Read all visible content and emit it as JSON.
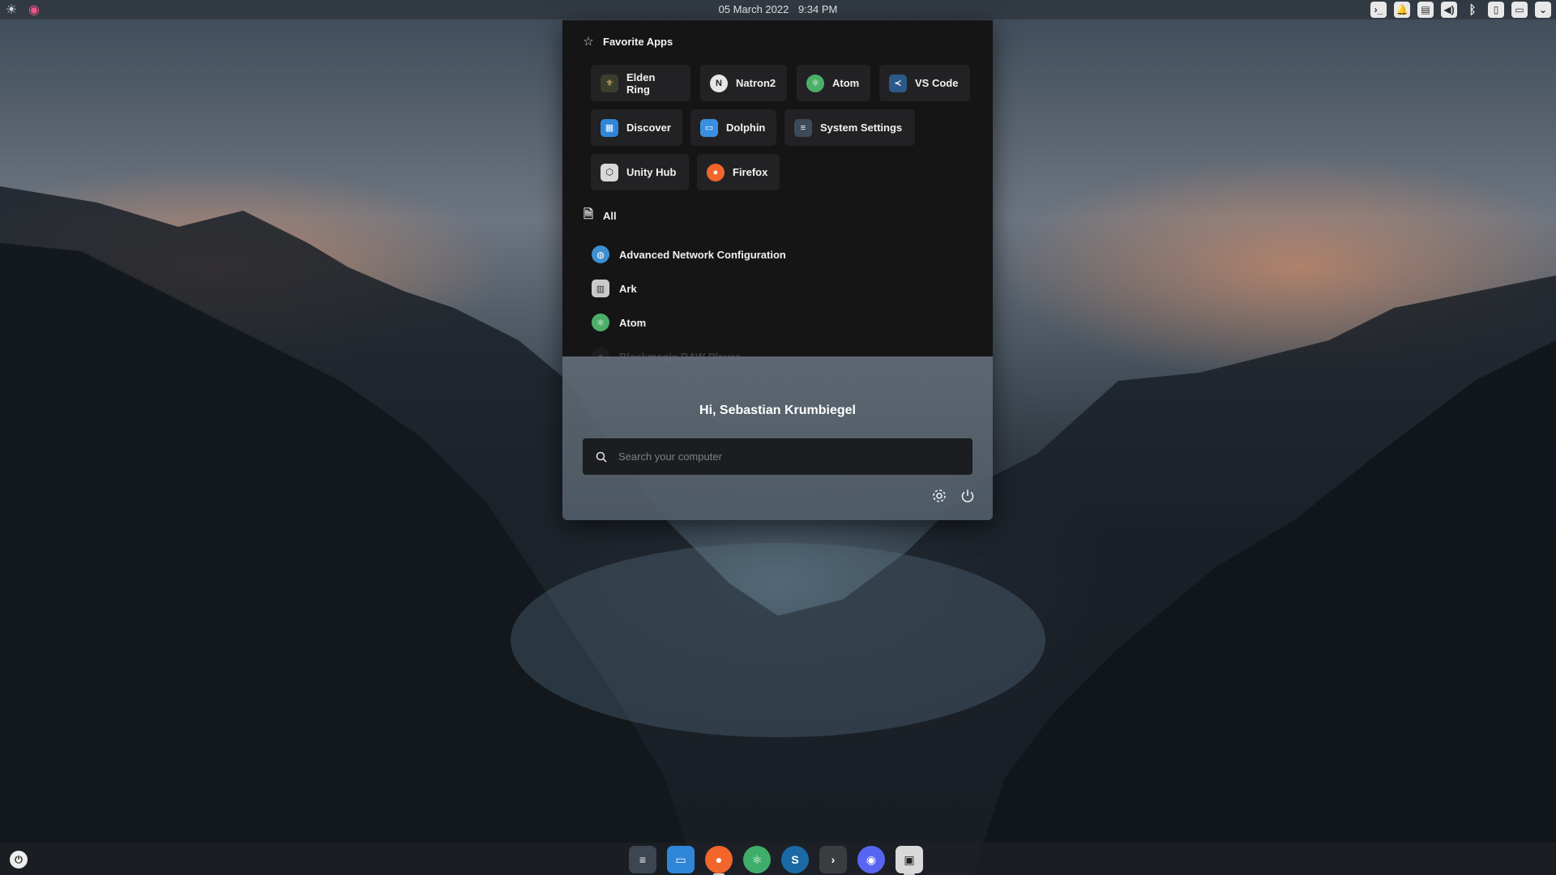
{
  "topbar": {
    "date": "05  March 2022",
    "time": "9:34 PM"
  },
  "launcher": {
    "favorites_heading": "Favorite Apps",
    "favorites": [
      {
        "label": "Elden Ring",
        "icon": "elden-ring-icon",
        "color": "#3a3f2c"
      },
      {
        "label": "Natron2",
        "icon": "natron-icon",
        "color": "#e6e6e6"
      },
      {
        "label": "Atom",
        "icon": "atom-icon",
        "color": "#4caf69"
      },
      {
        "label": "VS Code",
        "icon": "vscode-icon",
        "color": "#2b5a8a"
      },
      {
        "label": "Discover",
        "icon": "discover-icon",
        "color": "#2f86d8"
      },
      {
        "label": "Dolphin",
        "icon": "dolphin-icon",
        "color": "#3b8fe0"
      },
      {
        "label": "System Settings",
        "icon": "system-settings-icon",
        "color": "#3d4a5a"
      },
      {
        "label": "Unity Hub",
        "icon": "unity-hub-icon",
        "color": "#d8d8d8"
      },
      {
        "label": "Firefox",
        "icon": "firefox-icon",
        "color": "#f2662b"
      }
    ],
    "all_heading": "All",
    "all_apps": [
      {
        "label": "Advanced Network Configuration",
        "icon": "network-globe-icon",
        "color": "#3e8fd0"
      },
      {
        "label": "Ark",
        "icon": "ark-icon",
        "color": "#c9c9c9"
      },
      {
        "label": "Atom",
        "icon": "atom-icon",
        "color": "#4caf69"
      },
      {
        "label": "Blackmagic RAW Player",
        "icon": "blackmagic-icon",
        "color": "#444444"
      }
    ],
    "greeting": "Hi, Sebastian Krumbiegel",
    "search_placeholder": "Search your computer"
  },
  "dock": {
    "apps": [
      {
        "name": "system-settings-icon",
        "color": "#3d4550",
        "glyph": "≡"
      },
      {
        "name": "dolphin-icon",
        "color": "#2f86d8",
        "glyph": "▭"
      },
      {
        "name": "firefox-icon",
        "color": "#f2662b",
        "glyph": "●"
      },
      {
        "name": "atom-icon",
        "color": "#3fae6a",
        "glyph": "⚛"
      },
      {
        "name": "steam-icon",
        "color": "#1b6aa5",
        "glyph": "S"
      },
      {
        "name": "terminal-icon",
        "color": "#3a3d40",
        "glyph": "›"
      },
      {
        "name": "discord-icon",
        "color": "#5865f2",
        "glyph": "◉"
      },
      {
        "name": "game-icon",
        "color": "#d9d9d9",
        "glyph": "▣"
      }
    ]
  }
}
